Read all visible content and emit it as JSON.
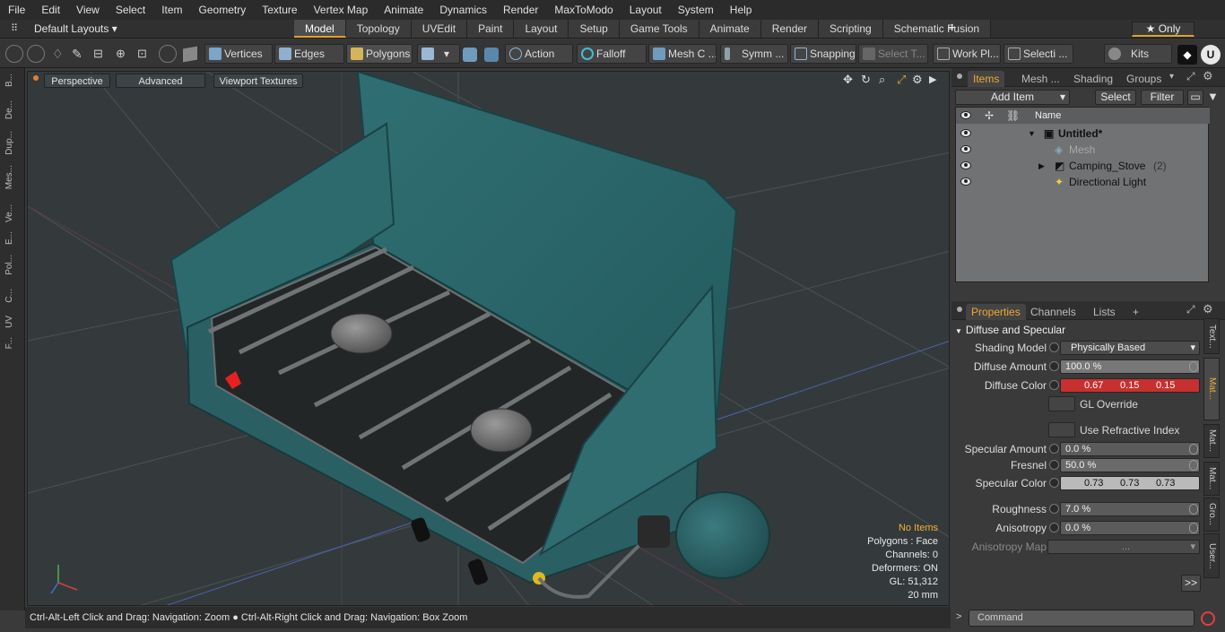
{
  "menu": [
    "File",
    "Edit",
    "View",
    "Select",
    "Item",
    "Geometry",
    "Texture",
    "Vertex Map",
    "Animate",
    "Dynamics",
    "Render",
    "MaxToModo",
    "Layout",
    "System",
    "Help"
  ],
  "layouts_label": "Default Layouts ▾",
  "layout_tabs": [
    "Model",
    "Topology",
    "UVEdit",
    "Paint",
    "Layout",
    "Setup",
    "Game Tools",
    "Animate",
    "Render",
    "Scripting",
    "Schematic Fusion"
  ],
  "add_tab": "+",
  "only_label": "★ Only",
  "toolbar": {
    "vertices": "Vertices",
    "edges": "Edges",
    "polygons": "Polygons",
    "action": "Action",
    "falloff": "Falloff",
    "mesh_c": "Mesh C ...",
    "symm": "Symm ...",
    "snapping": "Snapping",
    "select_t": "Select T...",
    "work_pl": "Work Pl...",
    "selecti": "Selecti ...",
    "kits": "Kits"
  },
  "leftstrip": [
    "B...",
    "De...",
    "Dup...",
    "Mes...",
    "Ve...",
    "E...",
    "Pol...",
    "C...",
    "UV",
    "F..."
  ],
  "viewport": {
    "perspective": "Perspective",
    "advanced": "Advanced",
    "textures": "Viewport Textures",
    "info": {
      "no_items": "No Items",
      "polygons": "Polygons : Face",
      "channels": "Channels: 0",
      "deformers": "Deformers: ON",
      "gl": "GL: 51,312",
      "units": "20 mm"
    }
  },
  "status": "Ctrl-Alt-Left Click and Drag: Navigation: Zoom ● Ctrl-Alt-Right Click and Drag: Navigation: Box Zoom",
  "items_panel": {
    "tabs": [
      "Items",
      "Mesh ...",
      "Shading",
      "Groups"
    ],
    "add_item": "Add Item",
    "select": "Select",
    "filter": "Filter",
    "col_name": "Name",
    "rows": [
      {
        "name": "Untitled*",
        "count": ""
      },
      {
        "name": "Mesh",
        "count": ""
      },
      {
        "name": "Camping_Stove",
        "count": "(2)"
      },
      {
        "name": "Directional Light",
        "count": ""
      }
    ]
  },
  "props_panel": {
    "tabs": [
      "Properties",
      "Channels",
      "Lists",
      "+"
    ],
    "section": "Diffuse and Specular",
    "shading_model": {
      "label": "Shading Model",
      "value": "Physically Based"
    },
    "diffuse_amount": {
      "label": "Diffuse Amount",
      "value": "100.0 %"
    },
    "diffuse_color": {
      "label": "Diffuse Color",
      "r": "0.67",
      "g": "0.15",
      "b": "0.15",
      "hex": "#c83030"
    },
    "gl_override": "GL Override",
    "use_refractive": "Use Refractive Index",
    "specular_amount": {
      "label": "Specular Amount",
      "value": "0.0 %"
    },
    "fresnel": {
      "label": "Fresnel",
      "value": "50.0 %"
    },
    "specular_color": {
      "label": "Specular Color",
      "r": "0.73",
      "g": "0.73",
      "b": "0.73"
    },
    "roughness": {
      "label": "Roughness",
      "value": "7.0 %"
    },
    "anisotropy": {
      "label": "Anisotropy",
      "value": "0.0 %"
    },
    "anisotropy_map": {
      "label": "Anisotropy Map",
      "value": "..."
    },
    "more": ">>"
  },
  "side_tabs": [
    "Text...",
    "Mat...",
    "Mat...",
    "Mat...",
    "Gro...",
    "User..."
  ],
  "command_placeholder": "Command",
  "colors": {
    "accent": "#f0a830",
    "stove": "#2b6166",
    "viewport_bg": "#343a3c"
  }
}
